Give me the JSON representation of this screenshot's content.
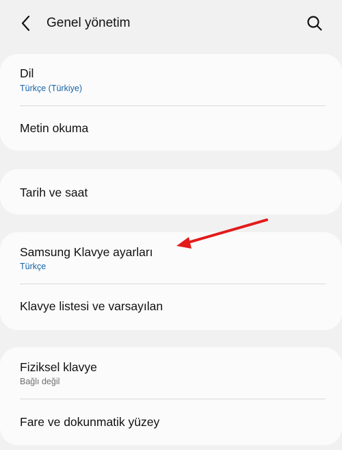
{
  "header": {
    "title": "Genel yönetim",
    "back_icon": "chevron-left-icon",
    "search_icon": "search-icon"
  },
  "groups": [
    {
      "items": [
        {
          "label": "Dil",
          "sub": "Türkçe (Türkiye)"
        },
        {
          "label": "Metin okuma"
        }
      ]
    },
    {
      "items": [
        {
          "label": "Tarih ve saat"
        }
      ]
    },
    {
      "items": [
        {
          "label": "Samsung Klavye ayarları",
          "sub": "Türkçe"
        },
        {
          "label": "Klavye listesi ve varsayılan"
        }
      ]
    },
    {
      "items": [
        {
          "label": "Fiziksel klavye",
          "sub": "Bağlı değil"
        },
        {
          "label": "Fare ve dokunmatik yüzey"
        }
      ]
    }
  ],
  "colors": {
    "background": "#f1f1f1",
    "card": "#fcfbfc",
    "sub_blue": "#1565a7",
    "sub_gray": "#6e6e6e",
    "annotation_arrow": "#e21b1b"
  }
}
